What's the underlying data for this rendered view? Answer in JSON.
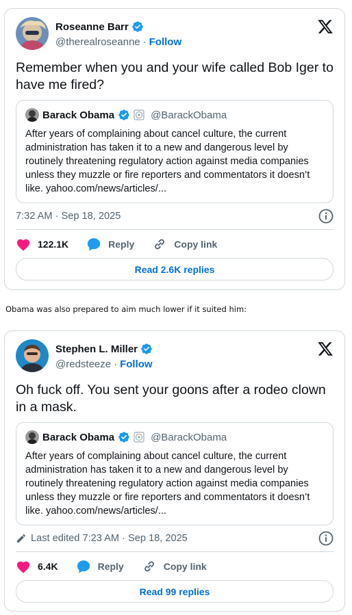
{
  "colors": {
    "accent": "#006fd6",
    "like": "#f91880",
    "verified": "#1d9bf0",
    "border": "#cfd9de",
    "muted": "#536471"
  },
  "tweets": [
    {
      "author": {
        "name": "Roseanne Barr",
        "handle": "@therealroseanne",
        "follow_label": "Follow"
      },
      "text": "Remember when you and your wife called Bob Iger to have me fired?",
      "quote": {
        "name": "Barack Obama",
        "handle": "@BarackObama",
        "text": "After years of complaining about cancel culture, the current administration has taken it to a new and dangerous level by routinely threatening regulatory action against media companies unless they muzzle or fire reporters and commentators it doesn’t like. yahoo.com/news/articles/..."
      },
      "timestamp": "7:32 AM · Sep 18, 2025",
      "likes": "122.1K",
      "reply_label": "Reply",
      "copy_label": "Copy link",
      "read_replies": "Read 2.6K replies"
    },
    {
      "author": {
        "name": "Stephen L. Miller",
        "handle": "@redsteeze",
        "follow_label": "Follow"
      },
      "text": "Oh fuck off. You sent your goons after a rodeo clown in a mask.",
      "quote": {
        "name": "Barack Obama",
        "handle": "@BarackObama",
        "text": "After years of complaining about cancel culture, the current administration has taken it to a new and dangerous level by routinely threatening regulatory action against media companies unless they muzzle or fire reporters and commentators it doesn’t like. yahoo.com/news/articles/..."
      },
      "timestamp": "Last edited 7:23 AM · Sep 18, 2025",
      "likes": "6.4K",
      "reply_label": "Reply",
      "copy_label": "Copy link",
      "read_replies": "Read 99 replies"
    }
  ],
  "between_text": "Obama was also prepared to aim much lower if it suited him:",
  "icons": [
    "verified-badge-icon",
    "x-logo-icon",
    "seal-icon",
    "info-icon",
    "heart-icon",
    "reply-bubble-icon",
    "link-icon",
    "pencil-icon"
  ]
}
